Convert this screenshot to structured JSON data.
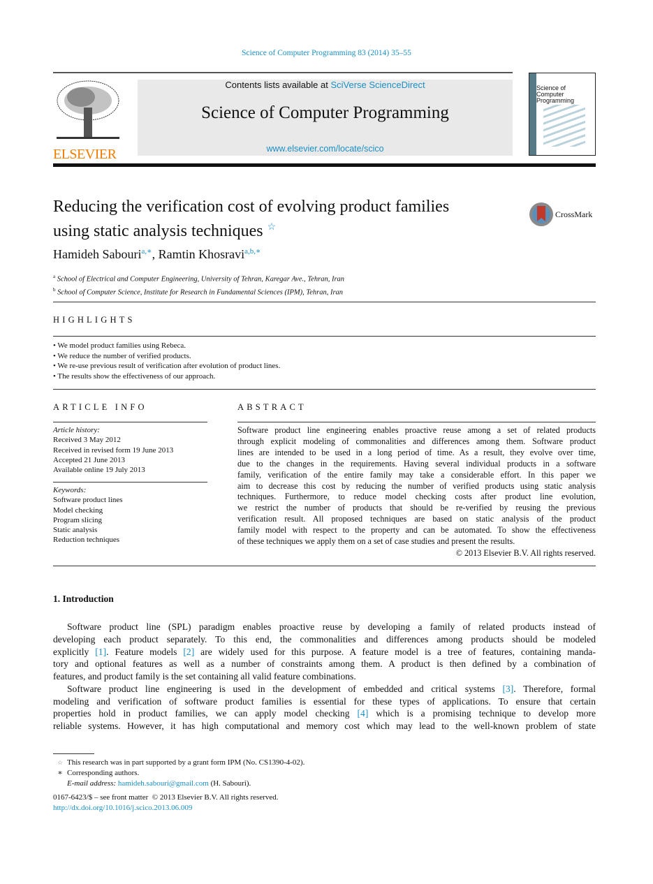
{
  "running_head": "Science of Computer Programming 83 (2014) 35–55",
  "masthead": {
    "contents_prefix": "Contents lists available at ",
    "contents_link": "SciVerse ScienceDirect",
    "journal": "Science of Computer Programming",
    "url": "www.elsevier.com/locate/scico",
    "publisher_logo": "ELSEVIER",
    "cover_title": "Science of Computer Programming"
  },
  "title_line1": "Reducing the verification cost of evolving product families",
  "title_line2": "using static analysis techniques",
  "title_mark": "☆",
  "crossmark": "CrossMark",
  "authors": [
    {
      "name": "Hamideh Sabouri",
      "sup": "a,∗"
    },
    {
      "name": "Ramtin Khosravi",
      "sup": "a,b,∗"
    }
  ],
  "affiliations": [
    {
      "sup": "a",
      "text": "School of Electrical and Computer Engineering, University of Tehran, Karegar Ave., Tehran, Iran"
    },
    {
      "sup": "b",
      "text": "School of Computer Science, Institute for Research in Fundamental Sciences (IPM), Tehran, Iran"
    }
  ],
  "highlights": {
    "heading": "HIGHLIGHTS",
    "items": [
      "We model product families using Rebeca.",
      "We reduce the number of verified products.",
      "We re-use previous result of verification after evolution of product lines.",
      "The results show the effectiveness of our approach."
    ]
  },
  "article_info": {
    "heading": "ARTICLE INFO",
    "history_label": "Article history:",
    "history": [
      "Received 3 May 2012",
      "Received in revised form 19 June 2013",
      "Accepted 21 June 2013",
      "Available online 19 July 2013"
    ],
    "keywords_label": "Keywords:",
    "keywords": [
      "Software product lines",
      "Model checking",
      "Program slicing",
      "Static analysis",
      "Reduction techniques"
    ]
  },
  "abstract": {
    "heading": "ABSTRACT",
    "lines": [
      "Software product line engineering enables proactive reuse among a set of related products",
      "through explicit modeling of commonalities and differences among them. Software product",
      "lines are intended to be used in a long period of time. As a result, they evolve over time,",
      "due to the changes in the requirements. Having several individual products in a software",
      "family, verification of the entire family may take a considerable effort. In this paper we",
      "aim to decrease this cost by reducing the number of verified products using static analysis",
      "techniques. Furthermore, to reduce model checking costs after product line evolution,",
      "we restrict the number of products that should be re-verified by reusing the previous",
      "verification result. All proposed techniques are based on static analysis of the product",
      "family model with respect to the property and can be automated. To show the effectiveness",
      "of these techniques we apply them on a set of case studies and present the results."
    ],
    "copyright": "© 2013 Elsevier B.V. All rights reserved."
  },
  "section": {
    "heading": "1.  Introduction",
    "lines": [
      [
        {
          "t": "Software product line (SPL) paradigm enables proactive reuse by developing a family of related products instead of"
        }
      ],
      [
        {
          "t": "developing each product separately. To this end, the commonalities and differences among products should be modeled"
        }
      ],
      [
        {
          "t": "explicitly "
        },
        {
          "c": "[1]"
        },
        {
          "t": ". Feature models "
        },
        {
          "c": "[2]"
        },
        {
          "t": " are widely used for this purpose. A feature model is a tree of features, containing manda-"
        }
      ],
      [
        {
          "t": "tory and optional features as well as a number of constraints among them. A product is then defined by a combination of"
        }
      ],
      [
        {
          "t": "features, and product family is the set containing all valid feature combinations."
        }
      ],
      [
        {
          "t": "Software product line engineering is used in the development of embedded and critical systems "
        },
        {
          "c": "[3]"
        },
        {
          "t": ". Therefore, formal"
        }
      ],
      [
        {
          "t": "modeling and verification of software product families is essential for these types of applications. To ensure that certain"
        }
      ],
      [
        {
          "t": "properties hold in product families, we can apply model checking "
        },
        {
          "c": "[4]"
        },
        {
          "t": " which is a promising technique to develop more"
        }
      ],
      [
        {
          "t": "reliable systems. However, it has high computational and memory cost which may lead to the well-known problem of state"
        }
      ]
    ]
  },
  "footnotes": {
    "star": "☆",
    "star_text": "This research was in part supported by a grant form IPM (No. CS1390-4-02).",
    "asterisk": "∗",
    "asterisk_text": "Corresponding authors.",
    "email_label": "E-mail address:",
    "email": "hamideh.sabouri@gmail.com",
    "email_suffix": " (H. Sabouri).",
    "issn": "0167-6423/$ – see front matter  © 2013 Elsevier B.V. All rights reserved.",
    "doi": "http://dx.doi.org/10.1016/j.scico.2013.06.009"
  },
  "colors": {
    "link": "#1a8fc4",
    "elsevier_orange": "#f07d00",
    "masthead_bg": "#e9e9e9"
  }
}
